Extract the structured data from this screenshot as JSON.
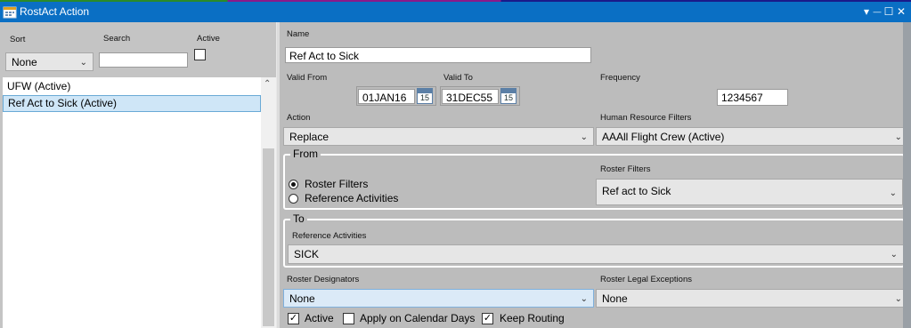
{
  "window": {
    "title": "RostAct Action",
    "controls": {
      "dropdown": "▾",
      "minimize": "—",
      "maximize": "☐",
      "close": "✕"
    }
  },
  "left": {
    "sort_label": "Sort",
    "sort_value": "None",
    "search_label": "Search",
    "search_value": "",
    "active_label": "Active",
    "active_checked": false,
    "list": [
      {
        "text": "UFW (Active)",
        "selected": false
      },
      {
        "text": "Ref Act to Sick (Active)",
        "selected": true
      }
    ]
  },
  "form": {
    "name_label": "Name",
    "name_value": "Ref Act to Sick",
    "valid_from_label": "Valid From",
    "valid_from_value": "01JAN16",
    "valid_to_label": "Valid To",
    "valid_to_value": "31DEC55",
    "calendar_day": "15",
    "frequency_label": "Frequency",
    "frequency_value": "1234567",
    "action_label": "Action",
    "action_value": "Replace",
    "hr_filters_label": "Human Resource Filters",
    "hr_filters_value": "AAAll Flight Crew (Active)",
    "from": {
      "title": "From",
      "option_roster": "Roster Filters",
      "option_reference": "Reference Activities",
      "selected": "roster",
      "roster_filters_label": "Roster Filters",
      "roster_filters_value": "Ref act to Sick"
    },
    "to": {
      "title": "To",
      "ref_activities_label": "Reference Activities",
      "ref_activities_value": "SICK"
    },
    "designators_label": "Roster Designators",
    "designators_value": "None",
    "legal_exceptions_label": "Roster Legal Exceptions",
    "legal_exceptions_value": "None",
    "checks": {
      "active_label": "Active",
      "active": true,
      "calendar_days_label": "Apply on Calendar Days",
      "calendar_days": false,
      "keep_routing_label": "Keep Routing",
      "keep_routing": true
    }
  },
  "colors": {
    "titlebar": "#0a6fc4",
    "selection": "#cfe6f7",
    "pane": "#c4c4c4"
  }
}
